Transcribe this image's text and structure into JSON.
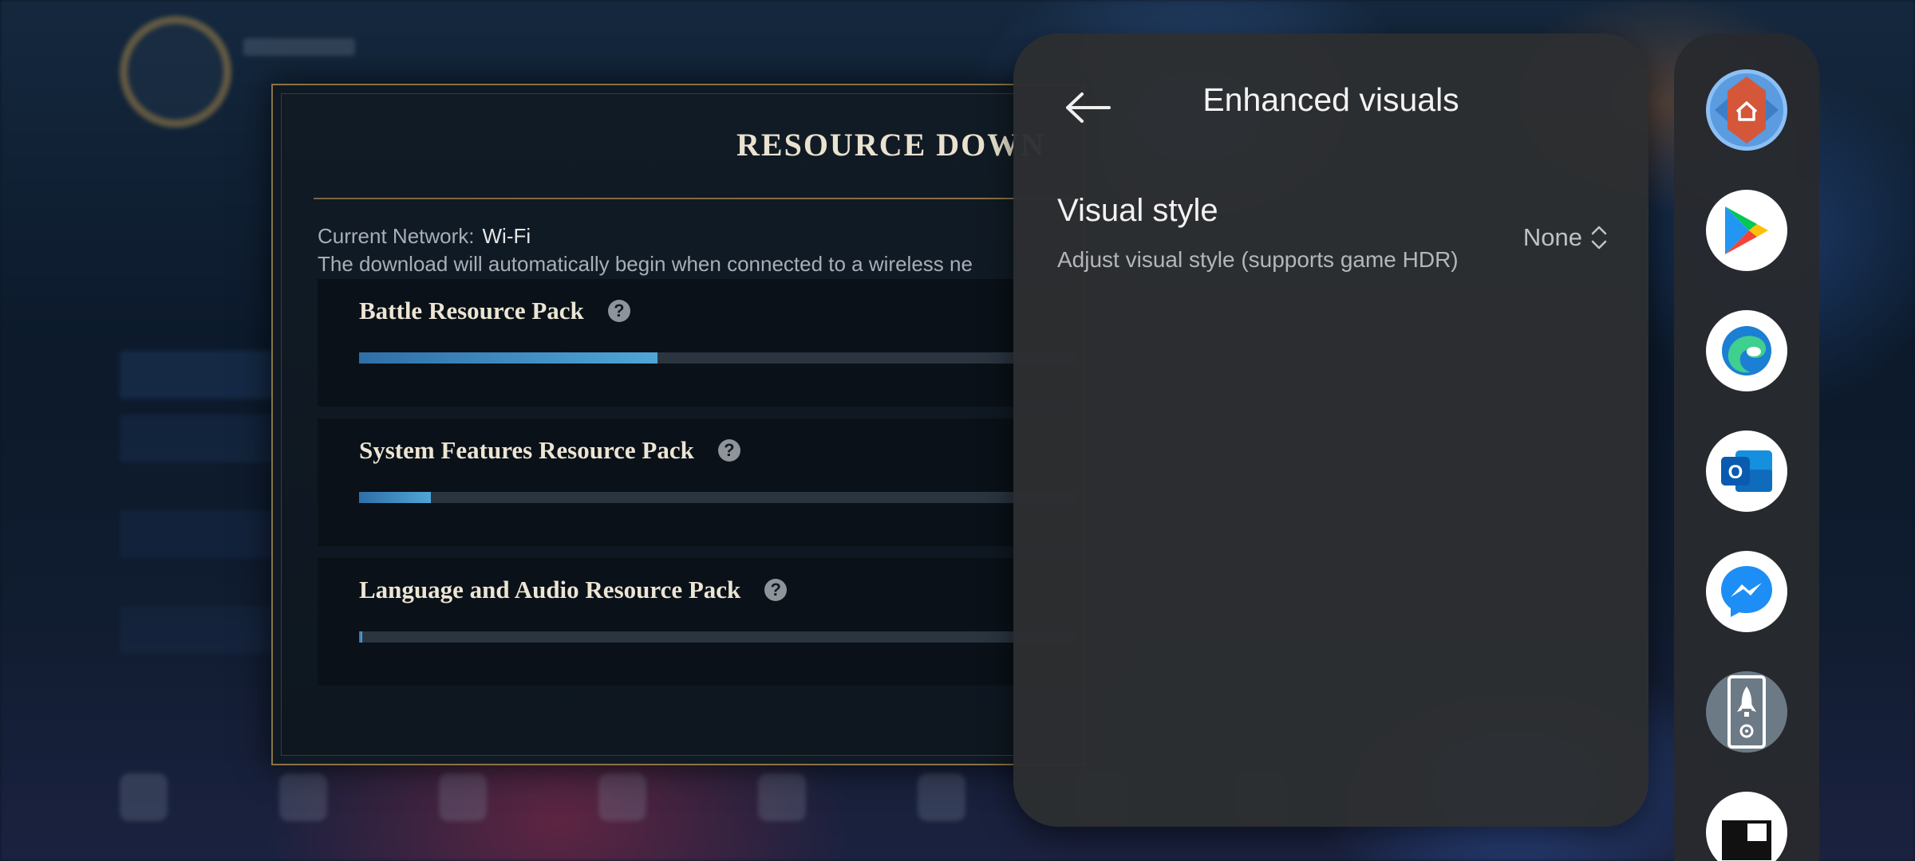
{
  "game_dialog": {
    "title": "RESOURCE DOWN",
    "network_label": "Current Network:",
    "network_value": "Wi-Fi",
    "auto_download_text": "The download will automatically begin when connected to a wireless ne",
    "packs": [
      {
        "name": "Battle Resource Pack",
        "progress": 0.415
      },
      {
        "name": "System Features Resource Pack",
        "progress": 0.1
      },
      {
        "name": "Language and Audio Resource Pack",
        "progress": 0.004
      }
    ]
  },
  "enhanced_visuals_panel": {
    "title": "Enhanced visuals",
    "back_icon": "arrow-left-icon",
    "setting": {
      "title": "Visual style",
      "description": "Adjust visual style (supports game HDR)",
      "value": "None",
      "value_icon": "chevron-up-down-icon"
    }
  },
  "app_dock": {
    "apps": [
      {
        "icon": "game-launcher-home-icon"
      },
      {
        "icon": "google-play-icon"
      },
      {
        "icon": "microsoft-edge-icon"
      },
      {
        "icon": "outlook-icon",
        "glyph": "O"
      },
      {
        "icon": "messenger-icon"
      },
      {
        "icon": "game-booster-rocket-icon"
      },
      {
        "icon": "partial-app-icon"
      }
    ]
  },
  "colors": {
    "progress_fill": "#4fa6d6",
    "dialog_border": "#8b7344",
    "panel_bg": "#2c2e31",
    "accent_launcher": "#d4573a"
  }
}
